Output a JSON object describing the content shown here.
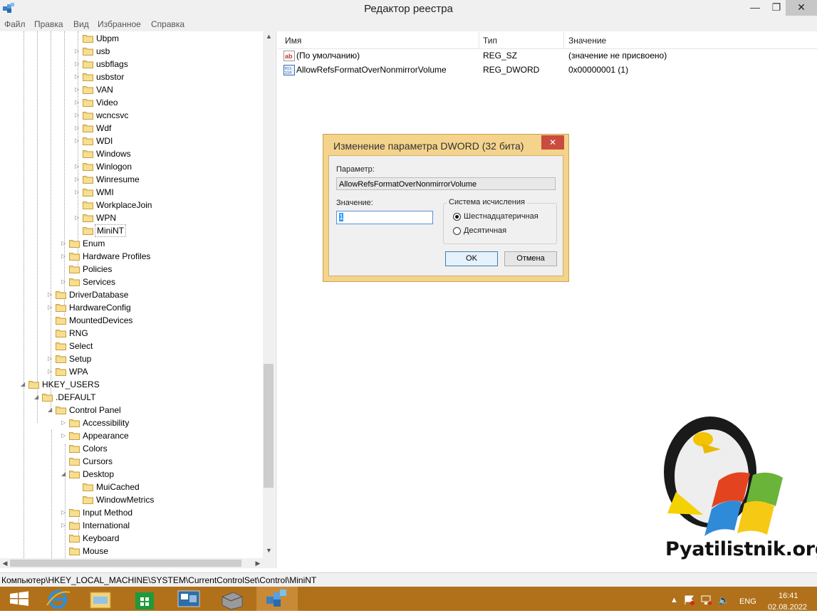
{
  "window": {
    "title": "Редактор реестра"
  },
  "menu": [
    "Файл",
    "Правка",
    "Вид",
    "Избранное",
    "Справка"
  ],
  "tree": [
    {
      "label": "Ubpm",
      "indent": 6,
      "expander": "none"
    },
    {
      "label": "usb",
      "indent": 6,
      "expander": "collapsed"
    },
    {
      "label": "usbflags",
      "indent": 6,
      "expander": "collapsed"
    },
    {
      "label": "usbstor",
      "indent": 6,
      "expander": "collapsed"
    },
    {
      "label": "VAN",
      "indent": 6,
      "expander": "collapsed"
    },
    {
      "label": "Video",
      "indent": 6,
      "expander": "collapsed"
    },
    {
      "label": "wcncsvc",
      "indent": 6,
      "expander": "collapsed"
    },
    {
      "label": "Wdf",
      "indent": 6,
      "expander": "collapsed"
    },
    {
      "label": "WDI",
      "indent": 6,
      "expander": "collapsed"
    },
    {
      "label": "Windows",
      "indent": 6,
      "expander": "none"
    },
    {
      "label": "Winlogon",
      "indent": 6,
      "expander": "collapsed"
    },
    {
      "label": "Winresume",
      "indent": 6,
      "expander": "collapsed"
    },
    {
      "label": "WMI",
      "indent": 6,
      "expander": "collapsed"
    },
    {
      "label": "WorkplaceJoin",
      "indent": 6,
      "expander": "none"
    },
    {
      "label": "WPN",
      "indent": 6,
      "expander": "collapsed"
    },
    {
      "label": "MiniNT",
      "indent": 6,
      "expander": "none",
      "selected": true
    },
    {
      "label": "Enum",
      "indent": 5,
      "expander": "collapsed"
    },
    {
      "label": "Hardware Profiles",
      "indent": 5,
      "expander": "collapsed"
    },
    {
      "label": "Policies",
      "indent": 5,
      "expander": "none"
    },
    {
      "label": "Services",
      "indent": 5,
      "expander": "collapsed"
    },
    {
      "label": "DriverDatabase",
      "indent": 4,
      "expander": "collapsed"
    },
    {
      "label": "HardwareConfig",
      "indent": 4,
      "expander": "collapsed"
    },
    {
      "label": "MountedDevices",
      "indent": 4,
      "expander": "none"
    },
    {
      "label": "RNG",
      "indent": 4,
      "expander": "none"
    },
    {
      "label": "Select",
      "indent": 4,
      "expander": "none"
    },
    {
      "label": "Setup",
      "indent": 4,
      "expander": "collapsed"
    },
    {
      "label": "WPA",
      "indent": 4,
      "expander": "collapsed"
    },
    {
      "label": "HKEY_USERS",
      "indent": 2,
      "expander": "expanded"
    },
    {
      "label": ".DEFAULT",
      "indent": 3,
      "expander": "expanded"
    },
    {
      "label": "Control Panel",
      "indent": 4,
      "expander": "expanded"
    },
    {
      "label": "Accessibility",
      "indent": 5,
      "expander": "collapsed"
    },
    {
      "label": "Appearance",
      "indent": 5,
      "expander": "collapsed"
    },
    {
      "label": "Colors",
      "indent": 5,
      "expander": "none"
    },
    {
      "label": "Cursors",
      "indent": 5,
      "expander": "none"
    },
    {
      "label": "Desktop",
      "indent": 5,
      "expander": "expanded"
    },
    {
      "label": "MuiCached",
      "indent": 6,
      "expander": "none"
    },
    {
      "label": "WindowMetrics",
      "indent": 6,
      "expander": "none"
    },
    {
      "label": "Input Method",
      "indent": 5,
      "expander": "collapsed"
    },
    {
      "label": "International",
      "indent": 5,
      "expander": "collapsed"
    },
    {
      "label": "Keyboard",
      "indent": 5,
      "expander": "none"
    },
    {
      "label": "Mouse",
      "indent": 5,
      "expander": "none"
    }
  ],
  "list": {
    "columns": [
      "Имя",
      "Тип",
      "Значение"
    ],
    "rows": [
      {
        "icon": "string-value-icon",
        "name": "(По умолчанию)",
        "type": "REG_SZ",
        "value": "(значение не присвоено)"
      },
      {
        "icon": "binary-value-icon",
        "name": "AllowRefsFormatOverNonmirrorVolume",
        "type": "REG_DWORD",
        "value": "0x00000001 (1)"
      }
    ]
  },
  "status": {
    "path": "Компьютер\\HKEY_LOCAL_MACHINE\\SYSTEM\\CurrentControlSet\\Control\\MiniNT"
  },
  "dialog": {
    "title": "Изменение параметра DWORD (32 бита)",
    "param_label": "Параметр:",
    "param_value": "AllowRefsFormatOverNonmirrorVolume",
    "value_label": "Значение:",
    "value": "1",
    "base_group": "Система исчисления",
    "hex_label": "Шестнадцатеричная",
    "dec_label": "Десятичная",
    "selected_base": "hex",
    "ok": "OK",
    "cancel": "Отмена"
  },
  "taskbar": {
    "items": [
      "start-icon",
      "internet-explorer-icon",
      "file-explorer-icon",
      "store-icon",
      "remote-desktop-icon",
      "server-manager-icon",
      "regedit-icon"
    ],
    "language": "ENG",
    "time": "16:41",
    "date": "02.08.2022"
  },
  "watermark": {
    "text": "Pyatilistnik.org"
  },
  "colors": {
    "dialog_frame": "#f4d38c",
    "taskbar": "#b1711b",
    "close_red": "#c94c3e"
  }
}
